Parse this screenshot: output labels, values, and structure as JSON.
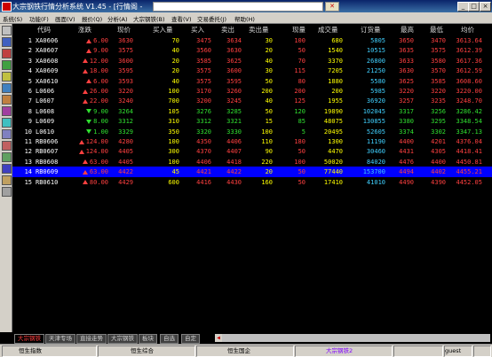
{
  "window": {
    "title": "大宗钢铁行情分析系统 V1.45 - [行情阁 -",
    "title_field": "",
    "min_label": "_",
    "max_label": "□",
    "close_label": "×"
  },
  "menu": [
    "系统(S)",
    "功能(F)",
    "画面(V)",
    "报价(Q)",
    "分析(A)",
    "大宗钢铁(B)",
    "查看(V)",
    "交易委托(J)",
    "帮助(H)"
  ],
  "columns": [
    "代码",
    "涨跌",
    "现价",
    "买入量",
    "买入",
    "卖出",
    "卖出量",
    "现量",
    "成交量",
    "订货量",
    "最高",
    "最低",
    "均价"
  ],
  "rows": [
    {
      "idx": "1",
      "code": "XA0606",
      "dir": "up",
      "change": "6.00",
      "price": "3630",
      "bid_vol": "70",
      "bid": "3475",
      "ask": "3634",
      "ask_vol": "30",
      "cur_vol": "100",
      "volume": "680",
      "oi": "5805",
      "high": "3650",
      "low": "3470",
      "avg": "3613.64"
    },
    {
      "idx": "2",
      "code": "XA0607",
      "dir": "up",
      "change": "9.00",
      "price": "3575",
      "bid_vol": "40",
      "bid": "3560",
      "ask": "3630",
      "ask_vol": "20",
      "cur_vol": "50",
      "volume": "1540",
      "oi": "10515",
      "high": "3635",
      "low": "3575",
      "avg": "3612.39"
    },
    {
      "idx": "3",
      "code": "XA0608",
      "dir": "up",
      "change": "12.00",
      "price": "3600",
      "bid_vol": "20",
      "bid": "3585",
      "ask": "3625",
      "ask_vol": "40",
      "cur_vol": "70",
      "volume": "3370",
      "oi": "26800",
      "high": "3633",
      "low": "3580",
      "avg": "3617.36"
    },
    {
      "idx": "4",
      "code": "XA0609",
      "dir": "up",
      "change": "18.00",
      "price": "3595",
      "bid_vol": "20",
      "bid": "3575",
      "ask": "3600",
      "ask_vol": "30",
      "cur_vol": "115",
      "volume": "7205",
      "oi": "21250",
      "high": "3630",
      "low": "3570",
      "avg": "3612.59"
    },
    {
      "idx": "5",
      "code": "XA0610",
      "dir": "up",
      "change": "6.00",
      "price": "3593",
      "bid_vol": "40",
      "bid": "3575",
      "ask": "3595",
      "ask_vol": "50",
      "cur_vol": "80",
      "volume": "1880",
      "oi": "5580",
      "high": "3625",
      "low": "3585",
      "avg": "3608.60"
    },
    {
      "idx": "6",
      "code": "L0606",
      "dir": "up",
      "change": "26.00",
      "price": "3220",
      "bid_vol": "100",
      "bid": "3170",
      "ask": "3260",
      "ask_vol": "200",
      "cur_vol": "200",
      "volume": "200",
      "oi": "5985",
      "high": "3220",
      "low": "3220",
      "avg": "3220.00"
    },
    {
      "idx": "7",
      "code": "L0607",
      "dir": "up",
      "change": "22.00",
      "price": "3240",
      "bid_vol": "700",
      "bid": "3200",
      "ask": "3245",
      "ask_vol": "40",
      "cur_vol": "125",
      "volume": "1955",
      "oi": "36920",
      "high": "3257",
      "low": "3235",
      "avg": "3248.70"
    },
    {
      "idx": "8",
      "code": "L0608",
      "dir": "dn",
      "change": "9.00",
      "price": "3264",
      "bid_vol": "105",
      "bid": "3276",
      "ask": "3285",
      "ask_vol": "50",
      "cur_vol": "120",
      "volume": "19890",
      "oi": "102045",
      "high": "3317",
      "low": "3256",
      "avg": "3286.42"
    },
    {
      "idx": "9",
      "code": "L0609",
      "dir": "dn",
      "change": "8.00",
      "price": "3312",
      "bid_vol": "310",
      "bid": "3312",
      "ask": "3321",
      "ask_vol": "15",
      "cur_vol": "85",
      "volume": "48075",
      "oi": "130855",
      "high": "3380",
      "low": "3295",
      "avg": "3348.54"
    },
    {
      "idx": "10",
      "code": "L0610",
      "dir": "dn",
      "change": "1.00",
      "price": "3329",
      "bid_vol": "350",
      "bid": "3320",
      "ask": "3330",
      "ask_vol": "100",
      "cur_vol": "5",
      "volume": "20495",
      "oi": "52605",
      "high": "3374",
      "low": "3302",
      "avg": "3347.13"
    },
    {
      "idx": "11",
      "code": "RB0606",
      "dir": "up",
      "change": "124.00",
      "price": "4280",
      "bid_vol": "100",
      "bid": "4350",
      "ask": "4406",
      "ask_vol": "110",
      "cur_vol": "180",
      "volume": "1300",
      "oi": "11190",
      "high": "4400",
      "low": "4201",
      "avg": "4376.04"
    },
    {
      "idx": "12",
      "code": "RB0607",
      "dir": "up",
      "change": "124.00",
      "price": "4405",
      "bid_vol": "300",
      "bid": "4370",
      "ask": "4407",
      "ask_vol": "90",
      "cur_vol": "50",
      "volume": "4470",
      "oi": "30460",
      "high": "4431",
      "low": "4305",
      "avg": "4418.41"
    },
    {
      "idx": "13",
      "code": "RB0608",
      "dir": "up",
      "change": "63.00",
      "price": "4405",
      "bid_vol": "100",
      "bid": "4406",
      "ask": "4418",
      "ask_vol": "220",
      "cur_vol": "100",
      "volume": "50020",
      "oi": "84020",
      "high": "4476",
      "low": "4400",
      "avg": "4450.81"
    },
    {
      "idx": "14",
      "code": "RB0609",
      "dir": "up",
      "change": "63.00",
      "price": "4422",
      "bid_vol": "45",
      "bid": "4421",
      "ask": "4422",
      "ask_vol": "20",
      "cur_vol": "50",
      "volume": "77440",
      "oi": "153700",
      "high": "4494",
      "low": "4402",
      "avg": "4455.21"
    },
    {
      "idx": "15",
      "code": "RB0610",
      "dir": "up",
      "change": "80.00",
      "price": "4429",
      "bid_vol": "600",
      "bid": "4416",
      "ask": "4430",
      "ask_vol": "160",
      "cur_vol": "50",
      "volume": "17410",
      "oi": "41010",
      "high": "4490",
      "low": "4390",
      "avg": "4452.05"
    }
  ],
  "selected_row": 13,
  "tabs": [
    "大宗钢铁",
    "天津专场",
    "直接走势",
    "大宗钢铁",
    "板块",
    "自选",
    "自定"
  ],
  "status": [
    "恒生指数",
    "恒生综合",
    "恒生国企",
    "大宗钢铁2",
    "",
    "guest",
    ""
  ],
  "colors": {
    "up": "#ff4040",
    "down": "#30e030",
    "selected_row": "#0000ff",
    "title_start": "#0a246a"
  }
}
